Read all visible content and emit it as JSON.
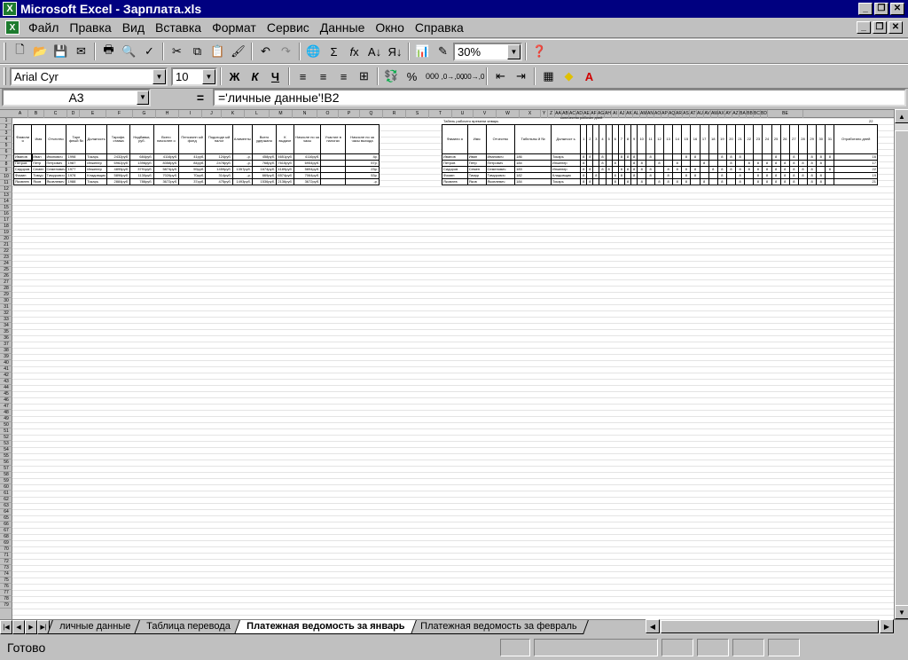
{
  "window": {
    "title": "Microsoft Excel - Зарплата.xls",
    "min_label": "_",
    "max_label": "❐",
    "close_label": "✕"
  },
  "menu": [
    "Файл",
    "Правка",
    "Вид",
    "Вставка",
    "Формат",
    "Сервис",
    "Данные",
    "Окно",
    "Справка"
  ],
  "toolbar": {
    "zoom": "30%",
    "font": "Arial Cyr",
    "size": "10",
    "bold": "Ж",
    "italic": "К",
    "underline": "Ч",
    "percent": "%",
    "thousands": "000",
    "inc_decimal": ",0→,00",
    "dec_decimal": ",00→,0"
  },
  "formula": {
    "cell": "A3",
    "eq": "=",
    "content": "='личные данные'!B2"
  },
  "columns": [
    "A",
    "B",
    "C",
    "D",
    "E",
    "F",
    "G",
    "H",
    "I",
    "J",
    "K",
    "L",
    "M",
    "N",
    "O",
    "P",
    "Q",
    "R",
    "S",
    "T",
    "U",
    "V",
    "W",
    "X",
    "Y",
    "Z",
    "AA",
    "AB",
    "AC",
    "AD",
    "AE",
    "AF",
    "AG",
    "AH",
    "AI",
    "AJ",
    "AK",
    "AL",
    "AM",
    "AN",
    "AO",
    "AP",
    "AQ",
    "AR",
    "AS",
    "AT",
    "AU",
    "AV",
    "AW",
    "AX",
    "AY",
    "AZ",
    "BA",
    "BB",
    "BC",
    "BD",
    "BE"
  ],
  "payroll": {
    "headers": [
      "Фамили я",
      "Имя",
      "Отчество",
      "Таре фный №",
      "Должность",
      "Тарифн. ставка",
      "Надбавки, руб.",
      "Всего начислен о",
      "Пенсионн ый фонд",
      "Подоходн ый налог",
      "Алименты",
      "Всего удержано",
      "К выдаче",
      "Начисле но за часы",
      "Участие в налогах",
      "Начисле но за часы выхода"
    ],
    "rows": [
      [
        "Иванов",
        "Иван",
        "Иванович",
        "1998",
        "Токарь",
        "2432руб.",
        "684руб.",
        "4116руб.",
        "41руб.",
        "124руб.",
        "-р.",
        "458руб.",
        "4651руб.",
        "4116руб.",
        "",
        "4р."
      ],
      [
        "Петров",
        "Петр",
        "Петрович",
        "1987",
        "Инженер",
        "6962руб.",
        "1396руб.",
        "8358руб.",
        "84руб.",
        "2478руб.",
        "-р.",
        "768руб.",
        "7615руб.",
        "6954руб.",
        "",
        "57р."
      ],
      [
        "Сидоров",
        "Семен",
        "Семенович",
        "1977",
        "Инженер",
        "4895руб.",
        "3791руб.",
        "5874руб.",
        "59руб.",
        "1459руб.",
        "1357руб.",
        "1674руб.",
        "4189руб.",
        "5894руб.",
        "",
        "23р."
      ],
      [
        "Фомин",
        "Тимур",
        "Тимурович",
        "1978",
        "Кладовщик",
        "5896руб.",
        "1130руб.",
        "7026руб.",
        "70руб.",
        "314руб.",
        "-р.",
        "669руб.",
        "6574руб.",
        "7064руб.",
        "",
        "53р."
      ],
      [
        "Яковлев",
        "Яков",
        "Яковлевич",
        "1988",
        "Токарь",
        "2884руб.",
        "786руб.",
        "3672руб.",
        "37руб.",
        "475руб.",
        "1493руб.",
        "1536руб.",
        "2136руб.",
        "3672руб.",
        "",
        "-р."
      ]
    ]
  },
  "timesheet": {
    "title": "Табель рабочего времени январь",
    "subtitle": "количество рабочих дней",
    "total_value": "22",
    "headers_left": [
      "Фамили я",
      "Имя",
      "Отчество",
      "Табельны й №",
      "Должност ь"
    ],
    "days": [
      "1",
      "2",
      "3",
      "4",
      "5",
      "6",
      "7",
      "8",
      "9",
      "10",
      "11",
      "12",
      "13",
      "14",
      "15",
      "16",
      "17",
      "18",
      "19",
      "20",
      "21",
      "22",
      "23",
      "24",
      "25",
      "26",
      "27",
      "28",
      "29",
      "30",
      "31"
    ],
    "total_header": "Отработано дней",
    "rows": [
      {
        "left": [
          "Иванов",
          "Иван",
          "Иванович",
          "186",
          "Токарь"
        ],
        "marks": "88 8  888 8   88  888   8 8 8888  8",
        "total": "16"
      },
      {
        "left": [
          "Петров",
          "Петр",
          "Петрович",
          "184",
          "Инженер"
        ],
        "marks": "8  8 8  88 8 8  8  8 888888888 8",
        "total": "17"
      },
      {
        "left": [
          "Сидоров",
          "Семен",
          "Семенович",
          "183",
          "Инженер"
        ],
        "marks": "88 88 88888 8888 888888888888 8",
        "total": "22"
      },
      {
        "left": [
          "Фомин",
          "Тимур",
          "Тимурович",
          "182",
          "Кладовщик"
        ],
        "marks": "8 8  88 8 8 8 88  8 8 88888888",
        "total": "19"
      },
      {
        "left": [
          "Яковлев",
          "Яков",
          "Яковлевич",
          "184",
          "Токарь"
        ],
        "marks": "88   8 8 8 8888 8 8 8 88888 88 8",
        "total": "21"
      }
    ]
  },
  "sheet_tabs": [
    "личные данные",
    "Таблица перевода",
    "Платежная ведомость за январь",
    "Платежная ведомость за  февраль"
  ],
  "active_tab": 2,
  "status": {
    "text": "Готово"
  }
}
